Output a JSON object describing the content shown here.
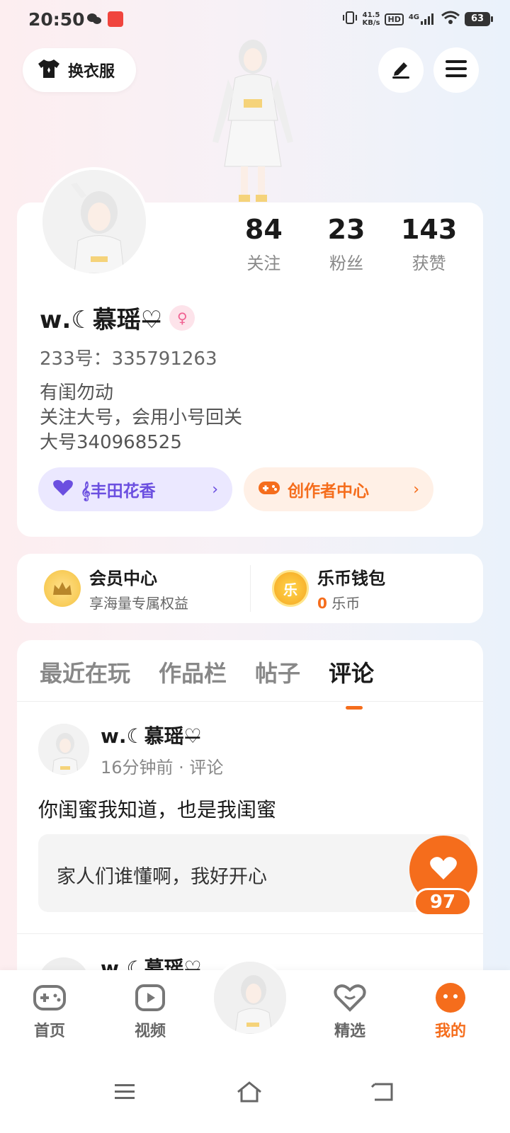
{
  "status_bar": {
    "time": "20:50",
    "net_speed_value": "41.5",
    "net_speed_unit": "KB/s",
    "hd": "HD",
    "signal": "4G",
    "battery": "63"
  },
  "header": {
    "outfit_label": "换衣服"
  },
  "profile": {
    "stats": [
      {
        "value": "84",
        "label": "关注"
      },
      {
        "value": "23",
        "label": "粉丝"
      },
      {
        "value": "143",
        "label": "获赞"
      }
    ],
    "username": "ᴡ.☾慕瑶♡̶",
    "gender_symbol": "♀",
    "uid": "233号：335791263",
    "bio_lines": [
      "有闺勿动",
      "关注大号，会用小号回关",
      "大号340968525"
    ],
    "tag_label": "𝄞丰田花香",
    "creator_label": "创作者中心"
  },
  "vip": {
    "member_title": "会员中心",
    "member_sub": "享海量专属权益",
    "wallet_title": "乐币钱包",
    "wallet_icon_char": "乐",
    "wallet_amount": "0",
    "wallet_unit": " 乐币"
  },
  "tabs": [
    {
      "label": "最近在玩",
      "active": false
    },
    {
      "label": "作品栏",
      "active": false
    },
    {
      "label": "帖子",
      "active": false
    },
    {
      "label": "评论",
      "active": true
    }
  ],
  "post": {
    "author": "ᴡ.☾慕瑶♡̶",
    "meta": "16分钟前 · 评论",
    "text": "你闺蜜我知道，也是我闺蜜",
    "quote": "家人们谁懂啊，我好开心"
  },
  "post2": {
    "author": "ᴡ.☾慕瑶♡̶"
  },
  "like": {
    "count": "97"
  },
  "bottom_nav": [
    {
      "label": "首页",
      "icon": "gamepad-icon"
    },
    {
      "label": "视频",
      "icon": "play-icon"
    },
    {
      "label": "精选",
      "icon": "heart-box-icon"
    },
    {
      "label": "我的",
      "icon": "face-icon"
    }
  ],
  "colors": {
    "accent": "#f56d1c",
    "purple": "#6b4fe0"
  }
}
